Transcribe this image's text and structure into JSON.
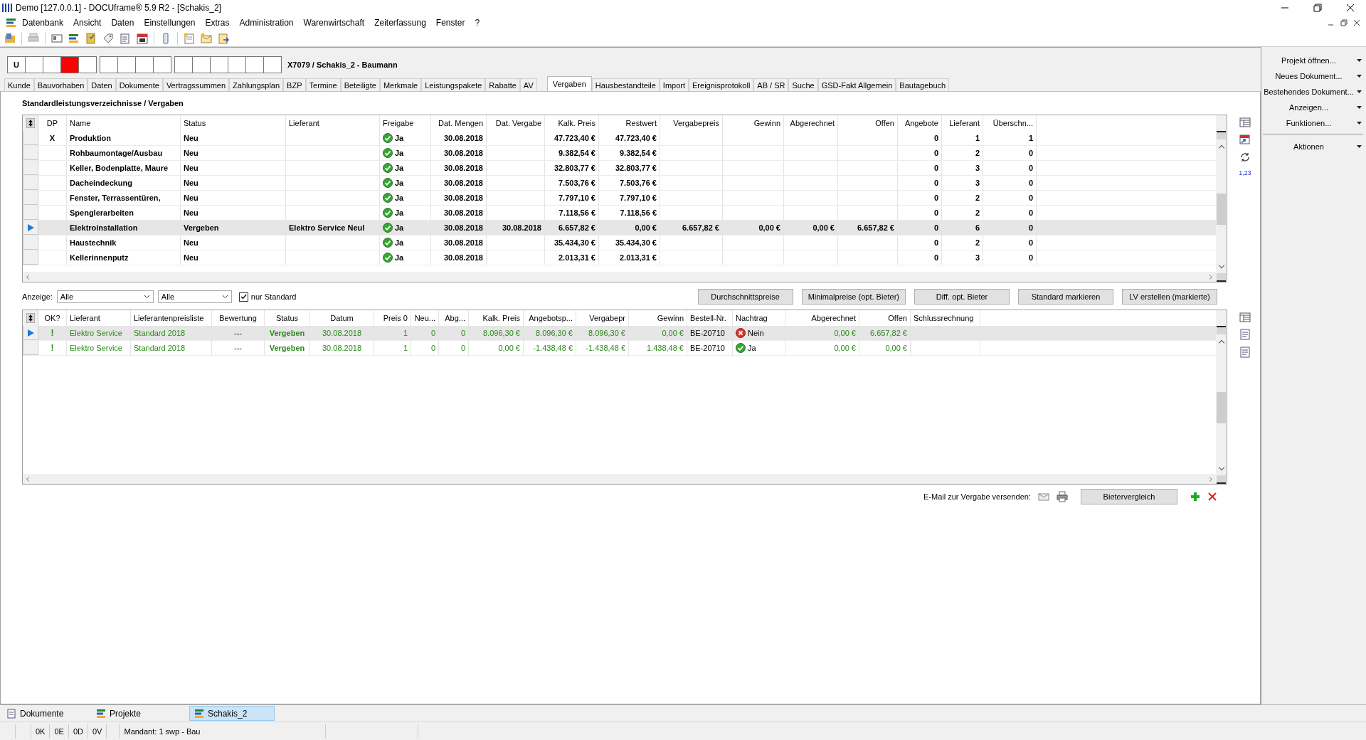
{
  "window": {
    "title": "Demo [127.0.0.1] - DOCUframe® 5.9 R2 - [Schakis_2]"
  },
  "menu": [
    {
      "label": "Datenbank"
    },
    {
      "label": "Ansicht"
    },
    {
      "label": "Daten"
    },
    {
      "label": "Einstellungen"
    },
    {
      "label": "Extras"
    },
    {
      "label": "Administration"
    },
    {
      "label": "Warenwirtschaft"
    },
    {
      "label": "Zeiterfassung"
    },
    {
      "label": "Fenster"
    },
    {
      "label": "?"
    }
  ],
  "record_header": {
    "box_groups": [
      [
        {
          "label": "U",
          "color": "#ffffff"
        },
        {
          "color": "#ffffff"
        },
        {
          "color": "#ffffff"
        },
        {
          "color": "#ff0000"
        },
        {
          "color": "#ffffff"
        }
      ],
      [
        {
          "color": "#ffffff"
        },
        {
          "color": "#ffffff"
        },
        {
          "color": "#ffffff"
        },
        {
          "color": "#ffffff"
        }
      ],
      [
        {
          "color": "#ffffff"
        },
        {
          "color": "#ffffff"
        },
        {
          "color": "#ffffff"
        },
        {
          "color": "#ffffff"
        },
        {
          "color": "#ffffff"
        },
        {
          "color": "#ffffff"
        }
      ]
    ],
    "title": "X7079 / Schakis_2 - Baumann"
  },
  "tabs": [
    {
      "label": "Kunde",
      "selected": false
    },
    {
      "label": "Bauvorhaben",
      "selected": false
    },
    {
      "label": "Daten",
      "selected": false
    },
    {
      "label": "Dokumente",
      "selected": false
    },
    {
      "label": "Vertragssummen",
      "selected": false
    },
    {
      "label": "Zahlungsplan",
      "selected": false
    },
    {
      "label": "BZP",
      "selected": false
    },
    {
      "label": "Termine",
      "selected": false
    },
    {
      "label": "Beteiligte",
      "selected": false
    },
    {
      "label": "Merkmale",
      "selected": false
    },
    {
      "label": "Leistungspakete",
      "selected": false
    },
    {
      "label": "Rabatte",
      "selected": false
    },
    {
      "label": "AV",
      "selected": false
    },
    {
      "label": "Vergaben",
      "selected": true
    },
    {
      "label": "Hausbestandteile",
      "selected": false
    },
    {
      "label": "Import",
      "selected": false
    },
    {
      "label": "Ereignisprotokoll",
      "selected": false
    },
    {
      "label": "AB / SR",
      "selected": false
    },
    {
      "label": "Suche",
      "selected": false
    },
    {
      "label": "GSD-Fakt Allgemein",
      "selected": false
    },
    {
      "label": "Bautagebuch",
      "selected": false
    }
  ],
  "section_title": "Standardleistungsverzeichnisse / Vergaben",
  "upper_table": {
    "columns": [
      {
        "label": "DP"
      },
      {
        "label": "Name"
      },
      {
        "label": "Status"
      },
      {
        "label": "Lieferant"
      },
      {
        "label": "Freigabe",
        "kind": "check"
      },
      {
        "label": "Dat. Mengen"
      },
      {
        "label": "Dat. Vergabe"
      },
      {
        "label": "Kalk. Preis"
      },
      {
        "label": "Restwert"
      },
      {
        "label": "Vergabepreis"
      },
      {
        "label": "Gewinn"
      },
      {
        "label": "Abgerechnet"
      },
      {
        "label": "Offen"
      },
      {
        "label": "Angebote"
      },
      {
        "label": "Lieferant"
      },
      {
        "label": "Überschn..."
      }
    ],
    "rows": [
      {
        "selected": false,
        "approved": true,
        "cells": [
          "X",
          "Produktion",
          "Neu",
          null,
          "Ja",
          "30.08.2018",
          null,
          "47.723,40 €",
          "47.723,40 €",
          null,
          null,
          null,
          null,
          "0",
          "1",
          "1"
        ]
      },
      {
        "selected": false,
        "approved": true,
        "cells": [
          null,
          "Rohbaumontage/Ausbau",
          "Neu",
          null,
          "Ja",
          "30.08.2018",
          null,
          "9.382,54 €",
          "9.382,54 €",
          null,
          null,
          null,
          null,
          "0",
          "2",
          "0"
        ]
      },
      {
        "selected": false,
        "approved": true,
        "cells": [
          null,
          "Keller, Bodenplatte, Maure",
          "Neu",
          null,
          "Ja",
          "30.08.2018",
          null,
          "32.803,77 €",
          "32.803,77 €",
          null,
          null,
          null,
          null,
          "0",
          "3",
          "0"
        ]
      },
      {
        "selected": false,
        "approved": true,
        "cells": [
          null,
          "Dacheindeckung",
          "Neu",
          null,
          "Ja",
          "30.08.2018",
          null,
          "7.503,76 €",
          "7.503,76 €",
          null,
          null,
          null,
          null,
          "0",
          "3",
          "0"
        ]
      },
      {
        "selected": false,
        "approved": true,
        "cells": [
          null,
          "Fenster, Terrassentüren,",
          "Neu",
          null,
          "Ja",
          "30.08.2018",
          null,
          "7.797,10 €",
          "7.797,10 €",
          null,
          null,
          null,
          null,
          "0",
          "2",
          "0"
        ]
      },
      {
        "selected": false,
        "approved": true,
        "cells": [
          null,
          "Spenglerarbeiten",
          "Neu",
          null,
          "Ja",
          "30.08.2018",
          null,
          "7.118,56 €",
          "7.118,56 €",
          null,
          null,
          null,
          null,
          "0",
          "2",
          "0"
        ]
      },
      {
        "selected": true,
        "approved": true,
        "cells": [
          null,
          "Elektroinstallation",
          "Vergeben",
          "Elektro Service Neul",
          "Ja",
          "30.08.2018",
          "30.08.2018",
          "6.657,82 €",
          "0,00 €",
          "6.657,82 €",
          "0,00 €",
          "0,00 €",
          "6.657,82 €",
          "0",
          "6",
          "0"
        ]
      },
      {
        "selected": false,
        "approved": true,
        "cells": [
          null,
          "Haustechnik",
          "Neu",
          null,
          "Ja",
          "30.08.2018",
          null,
          "35.434,30 €",
          "35.434,30 €",
          null,
          null,
          null,
          null,
          "0",
          "2",
          "0"
        ]
      },
      {
        "selected": false,
        "approved": true,
        "cells": [
          null,
          "Kellerinnenputz",
          "Neu",
          null,
          "Ja",
          "30.08.2018",
          null,
          "2.013,31 €",
          "2.013,31 €",
          null,
          null,
          null,
          null,
          "0",
          "3",
          "0"
        ]
      }
    ]
  },
  "grid_tools": {
    "number_format": "1,23"
  },
  "filter": {
    "label": "Anzeige:",
    "dropdowns": [
      {
        "value": "Alle"
      },
      {
        "value": "Alle"
      }
    ],
    "checkbox": {
      "label": "nur Standard",
      "checked": true
    },
    "buttons": [
      "Durchschnittspreise",
      "Minimalpreise (opt. Bieter)",
      "Diff. opt. Bieter",
      "Standard markieren",
      "LV erstellen (markierte)"
    ]
  },
  "lower_table": {
    "columns": [
      {
        "label": "OK?"
      },
      {
        "label": "Lieferant"
      },
      {
        "label": "Lieferantenpreisliste"
      },
      {
        "label": "Bewertung"
      },
      {
        "label": "Status"
      },
      {
        "label": "Datum"
      },
      {
        "label": "Preis 0"
      },
      {
        "label": "Neu..."
      },
      {
        "label": "Abg..."
      },
      {
        "label": "Kalk. Preis"
      },
      {
        "label": "Angebotsp..."
      },
      {
        "label": "Vergabepr"
      },
      {
        "label": "Gewinn"
      },
      {
        "label": "Bestell-Nr."
      },
      {
        "label": "Nachtrag",
        "kind": "check"
      },
      {
        "label": "Abgerechnet"
      },
      {
        "label": "Offen"
      },
      {
        "label": "Schlussrechnung"
      }
    ],
    "rows": [
      {
        "selected": true,
        "approved": false,
        "cells": [
          "!",
          "Elektro Service",
          "Standard 2018",
          "---",
          "Vergeben",
          "30.08.2018",
          "1",
          "0",
          "0",
          "8.096,30 €",
          "8.096,30 €",
          "8.096,30 €",
          "0,00 €",
          "BE-20710",
          "Nein",
          "0,00 €",
          "6.657,82 €",
          null
        ]
      },
      {
        "selected": false,
        "approved": true,
        "cells": [
          "!",
          "Elektro Service",
          "Standard 2018",
          "---",
          "Vergeben",
          "30.08.2018",
          "1",
          "0",
          "0",
          "0,00 €",
          "-1.438,48 €",
          "-1.438,48 €",
          "1.438,48 €",
          "BE-20710",
          "Ja",
          "0,00 €",
          "0,00 €",
          null
        ]
      }
    ]
  },
  "send_bar": {
    "label": "E-Mail zur Vergabe versenden:",
    "button": "Bietervergleich"
  },
  "side_panel": {
    "items": [
      {
        "label": "Projekt öffnen..."
      },
      {
        "label": "Neues Dokument..."
      },
      {
        "label": "Bestehendes Dokument..."
      },
      {
        "label": "Anzeigen..."
      },
      {
        "label": "Funktionen..."
      }
    ],
    "section": {
      "label": "Aktionen"
    }
  },
  "window_tabs": [
    {
      "label": "Dokumente",
      "selected": false
    },
    {
      "label": "Projekte",
      "selected": false
    },
    {
      "label": "Schakis_2",
      "selected": true
    }
  ],
  "status_bar": {
    "counters": [
      "0K",
      "0E",
      "0D",
      "0V"
    ],
    "client": "Mandant: 1 swp - Bau"
  }
}
